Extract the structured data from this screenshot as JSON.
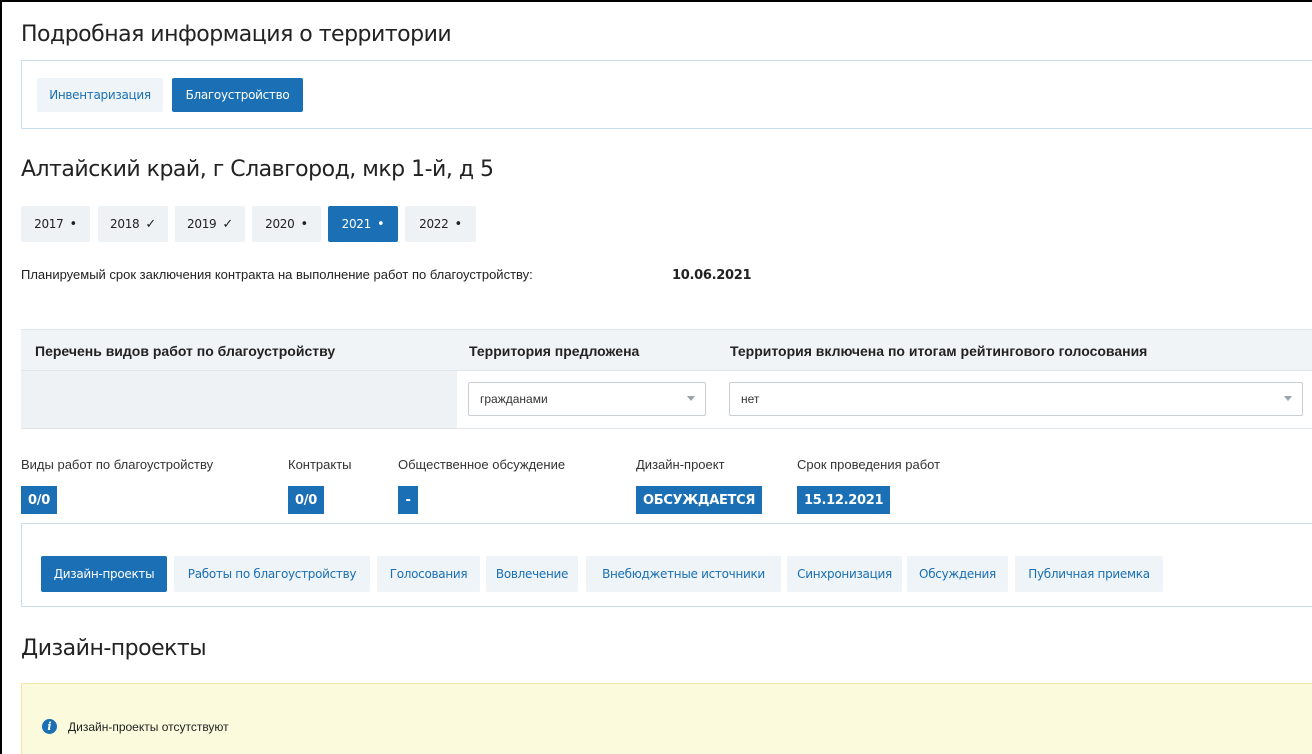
{
  "page_title": "Подробная информация о территории",
  "top_tabs": [
    {
      "label": "Инвентаризация",
      "active": false
    },
    {
      "label": "Благоустройство",
      "active": true
    }
  ],
  "address": "Алтайский край, г Славгород, мкр 1-й, д 5",
  "years": [
    {
      "label": "2017",
      "mark": "•",
      "active": false
    },
    {
      "label": "2018",
      "mark": "✓",
      "active": false
    },
    {
      "label": "2019",
      "mark": "✓",
      "active": false
    },
    {
      "label": "2020",
      "mark": "•",
      "active": false
    },
    {
      "label": "2021",
      "mark": "•",
      "active": true
    },
    {
      "label": "2022",
      "mark": "•",
      "active": false
    }
  ],
  "contract_plan": {
    "label": "Планируемый срок заключения контракта на выполнение работ по благоустройству:",
    "value": "10.06.2021"
  },
  "table": {
    "headers": [
      "Перечень видов работ по благоустройству",
      "Территория предложена",
      "Территория включена по итогам рейтингового голосования"
    ],
    "proposed_by": "гражданами",
    "included_by_vote": "нет"
  },
  "stats": [
    {
      "label": "Виды работ по благоустройству",
      "value": "0/0"
    },
    {
      "label": "Контракты",
      "value": "0/0"
    },
    {
      "label": "Общественное обсуждение",
      "value": "-"
    },
    {
      "label": "Дизайн-проект",
      "value": "ОБСУЖДАЕТСЯ"
    },
    {
      "label": "Срок проведения работ",
      "value": "15.12.2021"
    }
  ],
  "section_tabs": [
    {
      "label": "Дизайн-проекты",
      "active": true
    },
    {
      "label": "Работы по благоустройству",
      "active": false
    },
    {
      "label": "Голосования",
      "active": false
    },
    {
      "label": "Вовлечение",
      "active": false
    },
    {
      "label": "Внебюджетные источники",
      "active": false
    },
    {
      "label": "Синхронизация",
      "active": false
    },
    {
      "label": "Обсуждения",
      "active": false
    },
    {
      "label": "Публичная приемка",
      "active": false
    }
  ],
  "section_title": "Дизайн-проекты",
  "alert": {
    "icon": "info-icon",
    "text": "Дизайн-проекты отсутствуют"
  },
  "colors": {
    "accent": "#1a6fb5",
    "light_button": "#eef4f8",
    "alert_bg": "#fcfadd"
  }
}
